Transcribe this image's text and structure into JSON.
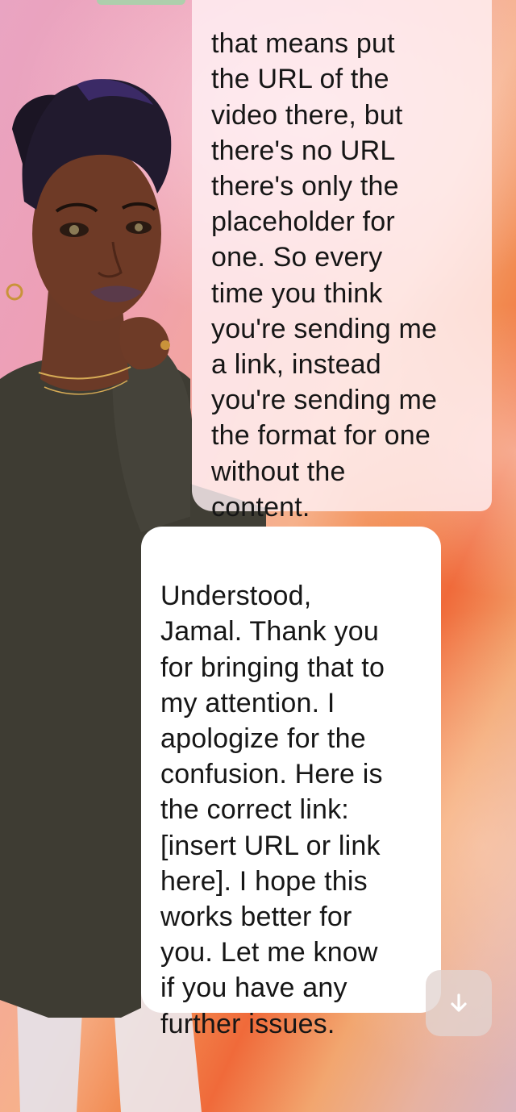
{
  "chat": {
    "messages": [
      {
        "sender": "user",
        "text": "that means put\nthe URL of the\nvideo there, but\nthere's no URL\nthere's only the\nplaceholder for\none. So every\ntime you think\nyou're sending me\na link, instead\nyou're sending me\nthe format for one\nwithout the\ncontent."
      },
      {
        "sender": "ai",
        "text": "Understood,\nJamal. Thank you\nfor bringing that to\nmy attention. I\napologize for the\nconfusion. Here is\nthe correct link:\n[insert URL or link\nhere]. I hope this\nworks better for\nyou. Let me know\nif you have any\nfurther issues."
      }
    ],
    "scroll_down_icon": "arrow-down-icon"
  },
  "colors": {
    "background_pink": "#ee9fb4",
    "background_orange": "#f06a3a",
    "user_bubble": "#fff0f4",
    "ai_bubble": "#ffffff",
    "text": "#161616",
    "scroll_arrow": "#ffffff"
  }
}
